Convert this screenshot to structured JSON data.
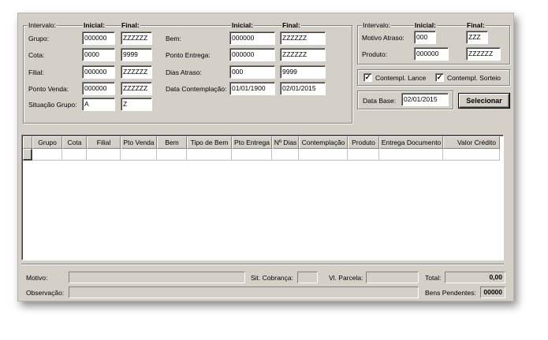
{
  "filters_left": {
    "intervalo_label": "Intervalo:",
    "inicial_header": "Inicial:",
    "final_header": "Final:",
    "grupo": {
      "label": "Grupo:",
      "inicial": "000000",
      "final": "ZZZZZZ"
    },
    "cota": {
      "label": "Cota:",
      "inicial": "0000",
      "final": "9999"
    },
    "filial": {
      "label": "Filial:",
      "inicial": "000000",
      "final": "ZZZZZZ"
    },
    "ponto_venda": {
      "label": "Ponto Venda:",
      "inicial": "000000",
      "final": "ZZZZZZ"
    },
    "situacao_grupo": {
      "label": "Situação Grupo:",
      "inicial": "A",
      "final": "Z"
    },
    "inicial_header_2": "Inicial:",
    "final_header_2": "Final:",
    "bem": {
      "label": "Bem:",
      "inicial": "000000",
      "final": "ZZZZZZ"
    },
    "ponto_entrega": {
      "label": "Ponto Entrega:",
      "inicial": "000000",
      "final": "ZZZZZZ"
    },
    "dias_atraso": {
      "label": "Dias Atraso:",
      "inicial": "000",
      "final": "9999"
    },
    "data_contemplacao": {
      "label": "Data Contemplação:",
      "inicial": "01/01/1900",
      "final": "02/01/2015"
    }
  },
  "filters_right": {
    "intervalo_label": "Intervalo:",
    "inicial_header": "Inicial:",
    "final_header": "Final:",
    "motivo_atraso": {
      "label": "Motivo Atraso:",
      "inicial": "000",
      "final": "ZZZ"
    },
    "produto": {
      "label": "Produto:",
      "inicial": "000000",
      "final": "ZZZZZZ"
    }
  },
  "checks": {
    "contempl_lance": {
      "label": "Contempl. Lance",
      "checked": true,
      "mark": "✓"
    },
    "contempl_sorteio": {
      "label": "Contempl. Sorteio",
      "checked": true,
      "mark": "✓"
    }
  },
  "data_base": {
    "label": "Data Base:",
    "value": "02/01/2015"
  },
  "selecionar_button": "Selecionar",
  "grid": {
    "columns": [
      "Grupo",
      "Cota",
      "Filial",
      "Pto Venda",
      "Bem",
      "Tipo de Bem",
      "Pto Entrega",
      "Nº Dias",
      "Contemplação",
      "Produto",
      "Entrega Documento",
      "Valor Crédito"
    ]
  },
  "footer": {
    "motivo_label": "Motivo:",
    "motivo_value": "",
    "sit_cobranca_label": "Sit. Cobrança:",
    "sit_cobranca_value": "",
    "vl_parcela_label": "Vl. Parcela:",
    "vl_parcela_value": "",
    "total_label": "Total:",
    "total_value": "0,00",
    "observacao_label": "Observação:",
    "observacao_value": "",
    "bens_pendentes_label": "Bens Pendentes:",
    "bens_pendentes_value": "00000"
  }
}
